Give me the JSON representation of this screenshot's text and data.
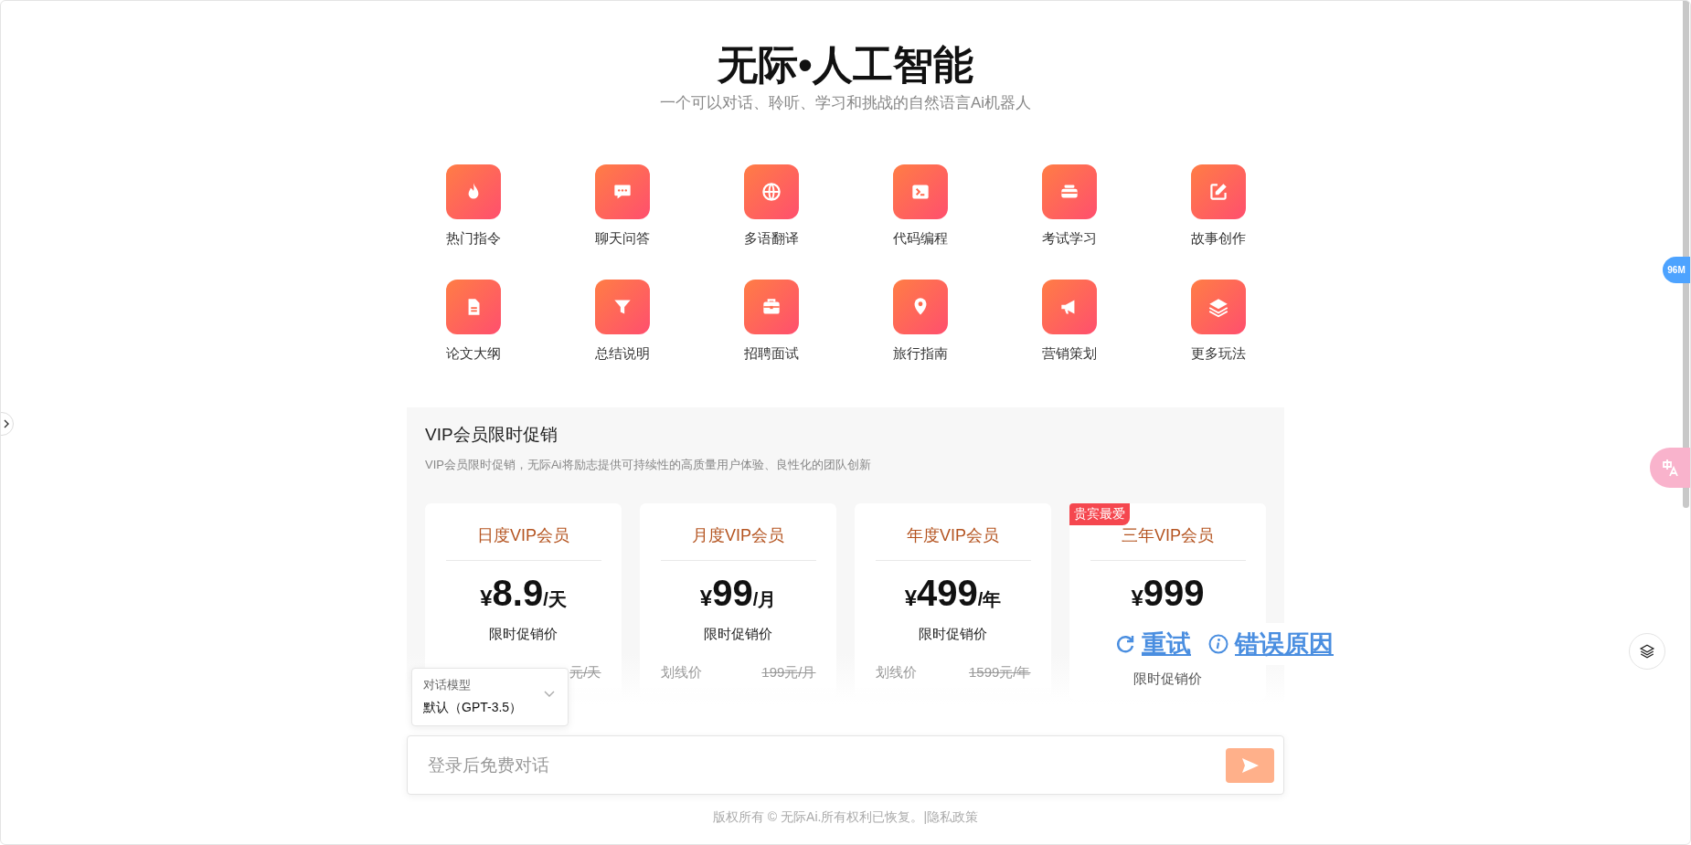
{
  "header": {
    "title": "无际•人工智能",
    "subtitle": "一个可以对话、聆听、学习和挑战的自然语言Ai机器人"
  },
  "features": [
    {
      "label": "热门指令"
    },
    {
      "label": "聊天问答"
    },
    {
      "label": "多语翻译"
    },
    {
      "label": "代码编程"
    },
    {
      "label": "考试学习"
    },
    {
      "label": "故事创作"
    },
    {
      "label": "论文大纲"
    },
    {
      "label": "总结说明"
    },
    {
      "label": "招聘面试"
    },
    {
      "label": "旅行指南"
    },
    {
      "label": "营销策划"
    },
    {
      "label": "更多玩法"
    }
  ],
  "promo": {
    "title": "VIP会员限时促销",
    "description": "VIP会员限时促销，无际Ai将励志提供可持续性的高质量用户体验、良性化的团队创新",
    "plans": [
      {
        "name": "日度VIP会员",
        "currency": "¥",
        "price": "8.9",
        "unit": "/天",
        "note": "限时促销价",
        "strike_price": "元/天"
      },
      {
        "name": "月度VIP会员",
        "currency": "¥",
        "price": "99",
        "unit": "/月",
        "note": "限时促销价",
        "strike_label": "划线价",
        "strike_price": "199元/月"
      },
      {
        "name": "年度VIP会员",
        "currency": "¥",
        "price": "499",
        "unit": "/年",
        "note": "限时促销价",
        "strike_label": "划线价",
        "strike_price": "1599元/年"
      },
      {
        "name": "三年VIP会员",
        "badge": "贵宾最爱",
        "currency": "¥",
        "price": "999",
        "note": "限时促销价",
        "error": {
          "retry": "重试",
          "reason": "错误原因"
        }
      }
    ]
  },
  "model_select": {
    "label": "对话模型",
    "value": "默认（GPT-3.5）"
  },
  "chat": {
    "placeholder": "登录后免费对话"
  },
  "footer": {
    "copyright": "版权所有 © 无际Ai.所有权利已恢复。|",
    "link": "隐私政策"
  },
  "side": {
    "memory_badge": "96M"
  }
}
